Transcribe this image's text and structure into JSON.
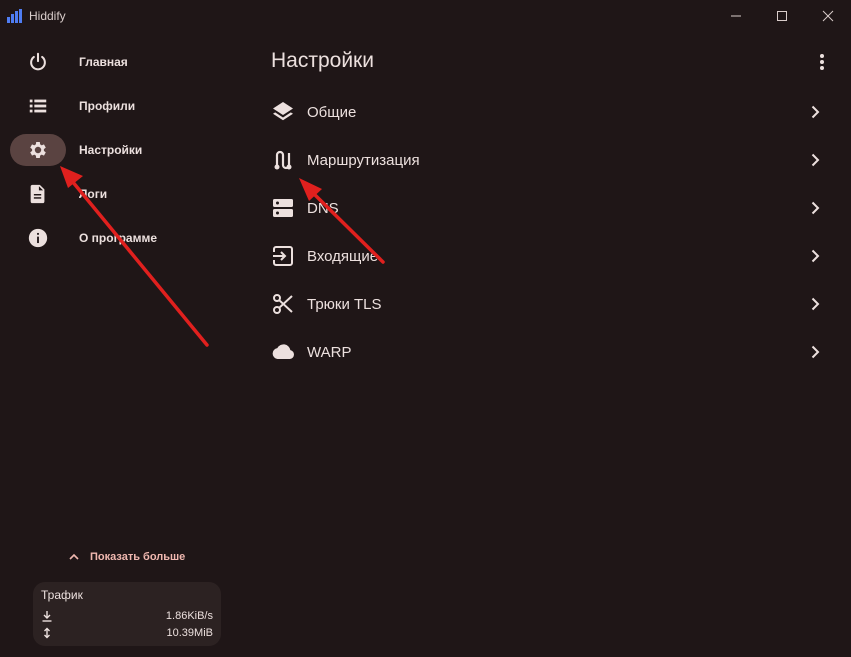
{
  "window": {
    "title": "Hiddify",
    "controls": [
      {
        "name": "minimize-icon"
      },
      {
        "name": "maximize-icon"
      },
      {
        "name": "close-icon"
      }
    ]
  },
  "sidebar": {
    "items": [
      {
        "label": "Главная",
        "icon": "power-icon",
        "active": false
      },
      {
        "label": "Профили",
        "icon": "list-icon",
        "active": false
      },
      {
        "label": "Настройки",
        "icon": "gear-icon",
        "active": true
      },
      {
        "label": "Логи",
        "icon": "document-icon",
        "active": false
      },
      {
        "label": "О программе",
        "icon": "info-icon",
        "active": false
      }
    ],
    "show_more": "Показать больше",
    "traffic": {
      "title": "Трафик",
      "download": "1.86KiB/s",
      "total": "10.39MiB"
    }
  },
  "main": {
    "title": "Настройки",
    "items": [
      {
        "label": "Общие",
        "icon": "layers-icon"
      },
      {
        "label": "Маршрутизация",
        "icon": "route-icon"
      },
      {
        "label": "DNS",
        "icon": "dns-icon"
      },
      {
        "label": "Входящие",
        "icon": "input-icon"
      },
      {
        "label": "Трюки TLS",
        "icon": "scissors-icon"
      },
      {
        "label": "WARP",
        "icon": "cloud-icon"
      }
    ]
  },
  "colors": {
    "background": "#1f1617",
    "active_pill": "#5a4341",
    "accent_text": "#f0b8b0",
    "text": "#ece0de",
    "annotation_arrow": "#e0201e",
    "logo_blue": "#4f7df3"
  }
}
